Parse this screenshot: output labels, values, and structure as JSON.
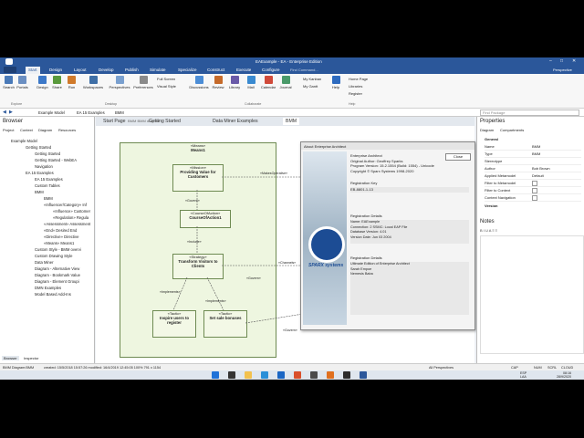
{
  "window": {
    "title": "EAExample - EA - Enterprise Edition",
    "search_placeholder": "Find Command..."
  },
  "ribbon": {
    "tabs": [
      "Start",
      "Design",
      "Layout",
      "Develop",
      "Publish",
      "Simulate",
      "Specialize",
      "Construct",
      "Execute",
      "Configure"
    ],
    "buttons": [
      "Search",
      "Portals",
      "Design",
      "Share",
      "Run",
      "Workspaces",
      "Perspectives",
      "Preferences",
      "Full Screen",
      "Visual Style",
      "Discussions",
      "Review",
      "Library",
      "Mail",
      "Calendar",
      "Journal",
      "Help",
      "Home Page",
      "Libraries",
      "Register"
    ],
    "small_buttons": [
      "My Kanban",
      "My Gantt"
    ],
    "groups": [
      "Explore",
      "Desktop",
      "Collaborate",
      "Help"
    ],
    "perspective_label": "Perspective"
  },
  "address": {
    "path": [
      "Example Model",
      "EA 15 Examples",
      "BMM"
    ],
    "search": "Find Package"
  },
  "browser": {
    "title": "Browser",
    "tabs": [
      "Project",
      "Context",
      "Diagram",
      "Resources"
    ],
    "items": [
      "Example Model",
      "Getting Started",
      "Getting Started",
      "Getting Started - WebEA",
      "Navigation",
      "EA 15 Examples",
      "EA 15 Examples",
      "Custom Tables",
      "BMM",
      "BMM",
      "«Influencer/Category» Inf",
      "«Influence» Customer",
      "«Regulation» Regula",
      "«Assessment» Assessment",
      "«End» Desired End",
      "«Directive» Directive",
      "«Means» Means1",
      "Custom Style - BMM overvi",
      "Custom Drawing Style",
      "Data Miner",
      "Diagram - Alternative View",
      "Diagram - Bookmark Value",
      "Diagram - Element Groupi",
      "DMN Examples",
      "Model Based Add-Ins"
    ],
    "bottom_tabs": [
      "Browser",
      "Inspector"
    ]
  },
  "doc_tabs": [
    "Start Page",
    "Getting Started",
    "Data Miner Examples",
    "BMM"
  ],
  "diagram": {
    "header": "BMM  BMM diagram",
    "elements": [
      {
        "stereo": "«Means»",
        "name": "Means1"
      },
      {
        "stereo": "«Mission»",
        "name": "Providing Value for Customers"
      },
      {
        "stereo": "«CourseOfAction»",
        "name": "CourseOfAction1"
      },
      {
        "stereo": "«Strategy»",
        "name": "Transform Visitors to Clients"
      },
      {
        "stereo": "«Tactic»",
        "name": "Inspire users to register"
      },
      {
        "stereo": "«Tactic»",
        "name": "Set sale bonuses"
      },
      {
        "stereo": "«BusinessPolicy»",
        "name": "Register Users"
      }
    ],
    "connectors": [
      "«Govern»",
      "«Include»",
      "«Implements»",
      "«Implements»",
      "«Govern»",
      "«MakesOperative»",
      "«Channels»",
      "«Govern»",
      "«AffectsAch»"
    ]
  },
  "about": {
    "title": "About Enterprise Architect",
    "close": "Close",
    "lines": [
      "Enterprise Architect",
      "Original Author: Geoffrey Sparks",
      "Program Version: 15.2.1554 (Build: 1554) - Unicode",
      "Copyright © Sparx Systems 1998-2020"
    ],
    "reg_key_label": "Registration Key",
    "reg_key": "EB-8801-1-13",
    "reg_details_label": "Registration Details",
    "reg_details": [
      "Name: EAExample",
      "Connection: 2 SSMC: Local EAP File",
      "Database Version: 4.01",
      "Version Date: Jun 03 2004"
    ],
    "reg_label": "Registration Details",
    "reg_text": [
      "Ultimate Edition of Enterprise Architect",
      "Sarah Empoe",
      "Nemesis Baba"
    ],
    "logo": "SPARX systems"
  },
  "properties": {
    "title": "Properties",
    "tabs": [
      "Diagram",
      "Compartments"
    ],
    "section": "General",
    "rows": [
      [
        "Name",
        "BMM"
      ],
      [
        "Type",
        "BMM"
      ],
      [
        "Stereotype",
        ""
      ],
      [
        "Author",
        "Bob Brown"
      ],
      [
        "Applied Metamodel",
        "Default"
      ],
      [
        "Filter to Metamodel",
        ""
      ],
      [
        "Filter to Context",
        ""
      ],
      [
        "Context Navigation",
        ""
      ]
    ],
    "section2": "Version",
    "notes_title": "Notes"
  },
  "status": {
    "left": "BMM Diagram:BMM",
    "created": "created: 15/5/2018 15:57:26  modified: 16/4/2019 12:45:05  100%  791 x 1154",
    "right": "All Perspectives",
    "caps": "CAP",
    "num": "NUM",
    "scrl": "SCRL",
    "cloud": "CLOUD"
  },
  "taskbar": {
    "lang": "ESP",
    "lang2": "LAA",
    "time": "08:16",
    "date": "28/9/2020"
  }
}
